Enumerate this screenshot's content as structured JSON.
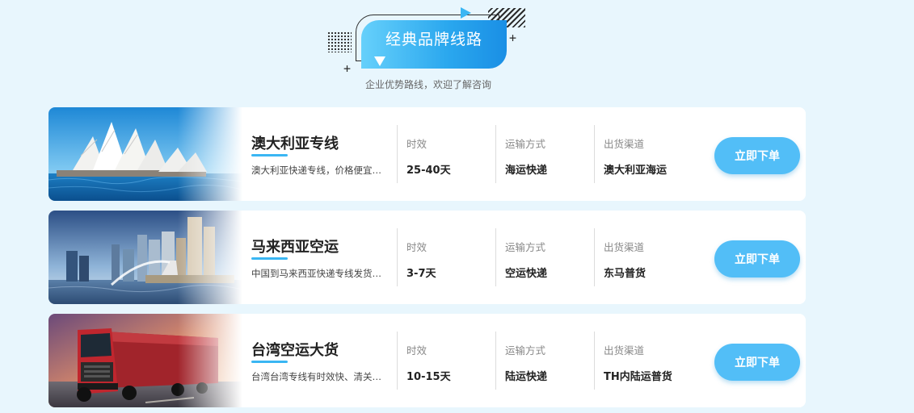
{
  "section": {
    "title": "经典品牌线路",
    "subtitle": "企业优势路线，欢迎了解咨询"
  },
  "colors": {
    "accent": "#3ab6f3",
    "button": "#52bef7",
    "background": "#e8f6fd",
    "card": "#ffffff"
  },
  "routes": [
    {
      "name": "澳大利亚专线",
      "description": "澳大利亚快递专线，价格便宜实惠",
      "image": "sydney-opera-house-image",
      "stats": [
        {
          "label": "时效",
          "value": "25-40天"
        },
        {
          "label": "运输方式",
          "value": "海运快递"
        },
        {
          "label": "出货渠道",
          "value": "澳大利亚海运"
        }
      ],
      "button_label": "立即下单"
    },
    {
      "name": "马来西亚空运",
      "description": "中国到马来西亚快递专线发货服务",
      "image": "singapore-merlion-skyline-image",
      "stats": [
        {
          "label": "时效",
          "value": "3-7天"
        },
        {
          "label": "运输方式",
          "value": "空运快递"
        },
        {
          "label": "出货渠道",
          "value": "东马普货"
        }
      ],
      "button_label": "立即下单"
    },
    {
      "name": "台湾空运大货",
      "description": "台湾台湾专线有时效快、清关快捷",
      "image": "red-truck-image",
      "stats": [
        {
          "label": "时效",
          "value": "10-15天"
        },
        {
          "label": "运输方式",
          "value": "陆运快递"
        },
        {
          "label": "出货渠道",
          "value": "TH内陆运普货"
        }
      ],
      "button_label": "立即下单"
    }
  ]
}
